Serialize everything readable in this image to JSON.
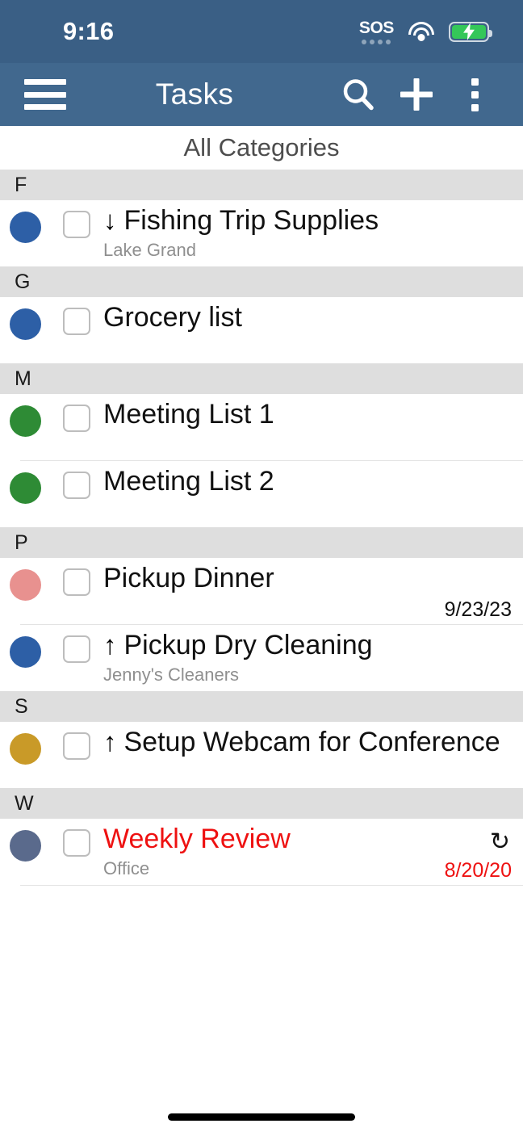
{
  "status_bar": {
    "time": "9:16",
    "sos_label": "SOS",
    "wifi_icon": "wifi-icon",
    "battery_icon": "battery-charging-icon",
    "background": "#3a5f85"
  },
  "toolbar": {
    "menu_icon": "hamburger-menu-icon",
    "title": "Tasks",
    "search_icon": "search-icon",
    "add_icon": "plus-icon",
    "overflow_icon": "kebab-menu-icon",
    "background": "#41688e"
  },
  "category_bar": {
    "label": "All Categories"
  },
  "colors": {
    "dot_blue": "#2d5fa6",
    "dot_green": "#2e8b35",
    "dot_pink": "#e8918f",
    "dot_gold": "#c99a28",
    "dot_slate": "#5a6a8c",
    "overdue_red": "#ee1111",
    "section_header_bg": "#dedede"
  },
  "sections": [
    {
      "letter": "F",
      "tasks": [
        {
          "dot_color": "#2d5fa6",
          "priority_icon": "↓",
          "priority_name": "low-priority-down-arrow",
          "title": "Fishing Trip Supplies",
          "note": "Lake Grand",
          "date": "",
          "overdue": false,
          "recurring": false,
          "divider_after": false
        }
      ]
    },
    {
      "letter": "G",
      "tasks": [
        {
          "dot_color": "#2d5fa6",
          "priority_icon": "",
          "priority_name": "",
          "title": "Grocery list",
          "note": "",
          "date": "",
          "overdue": false,
          "recurring": false,
          "divider_after": false
        }
      ]
    },
    {
      "letter": "M",
      "tasks": [
        {
          "dot_color": "#2e8b35",
          "priority_icon": "",
          "priority_name": "",
          "title": "Meeting List 1",
          "note": "",
          "date": "",
          "overdue": false,
          "recurring": false,
          "divider_after": true
        },
        {
          "dot_color": "#2e8b35",
          "priority_icon": "",
          "priority_name": "",
          "title": "Meeting List 2",
          "note": "",
          "date": "",
          "overdue": false,
          "recurring": false,
          "divider_after": false
        }
      ]
    },
    {
      "letter": "P",
      "tasks": [
        {
          "dot_color": "#e8918f",
          "priority_icon": "",
          "priority_name": "",
          "title": "Pickup Dinner",
          "note": "",
          "date": "9/23/23",
          "overdue": false,
          "recurring": false,
          "divider_after": true
        },
        {
          "dot_color": "#2d5fa6",
          "priority_icon": "↑",
          "priority_name": "high-priority-up-arrow",
          "title": "Pickup Dry Cleaning",
          "note": "Jenny's Cleaners",
          "date": "",
          "overdue": false,
          "recurring": false,
          "divider_after": false
        }
      ]
    },
    {
      "letter": "S",
      "tasks": [
        {
          "dot_color": "#c99a28",
          "priority_icon": "↑",
          "priority_name": "high-priority-up-arrow",
          "title": "Setup Webcam for Conference",
          "note": "",
          "date": "",
          "overdue": false,
          "recurring": false,
          "divider_after": false
        }
      ]
    },
    {
      "letter": "W",
      "tasks": [
        {
          "dot_color": "#5a6a8c",
          "priority_icon": "",
          "priority_name": "",
          "title": "Weekly Review",
          "note": "Office",
          "date": "8/20/20",
          "overdue": true,
          "recurring": true,
          "recurring_icon": "↻",
          "divider_after": true
        }
      ]
    }
  ],
  "home_indicator": "home-indicator-bar"
}
